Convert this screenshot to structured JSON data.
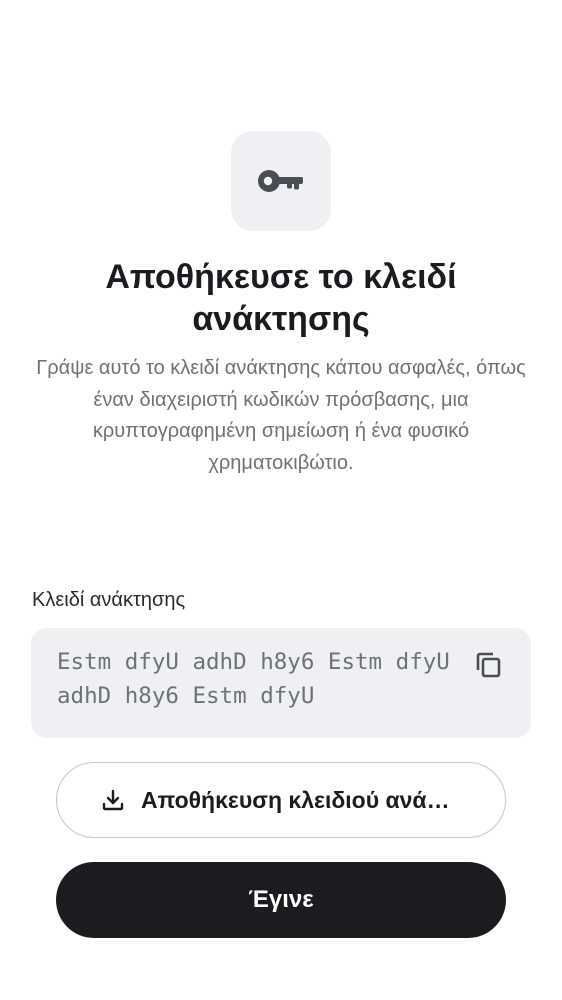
{
  "header": {
    "icon": "key-icon",
    "title": "Αποθήκευσε το κλειδί ανάκτησης",
    "description": "Γράψε αυτό το κλειδί ανάκτησης κάπου ασφαλές, όπως έναν διαχειριστή κωδικών πρόσβασης, μια κρυπτογραφημένη σημείωση ή ένα φυσικό χρηματοκιβώτιο."
  },
  "recovery_key": {
    "label": "Κλειδί ανάκτησης",
    "value": "Estm dfyU adhD h8y6 Estm dfyU adhD h8y6 Estm dfyU",
    "copy_icon": "copy-icon"
  },
  "actions": {
    "save_label": "Αποθήκευση κλειδιού ανάκτησης",
    "save_icon": "download-icon",
    "done_label": "Έγινε"
  },
  "colors": {
    "primary": "#1b1c20",
    "surface": "#eff0f4",
    "muted_text": "#6f717a"
  }
}
